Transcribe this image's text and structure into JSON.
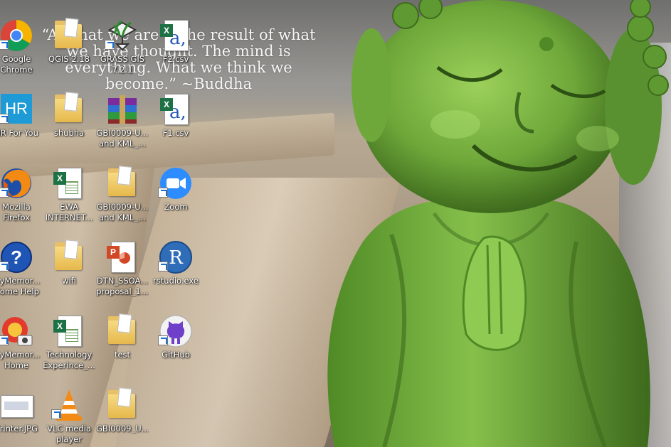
{
  "wallpaper": {
    "quote": "“All that we are is the result of what we have thought. The mind is everything. What we think we become.” ~Buddha",
    "statue_color": "#6fa83a"
  },
  "icons": [
    {
      "id": "chrome",
      "label": "Google\nChrome",
      "icon": "chrome-icon",
      "shortcut": true
    },
    {
      "id": "qgis",
      "label": "QGIS 2.18",
      "icon": "folder-icon",
      "shortcut": false
    },
    {
      "id": "grass",
      "label": "GRASS GIS\n7.2.1",
      "icon": "grass-gis-icon",
      "shortcut": true
    },
    {
      "id": "f2csv",
      "label": "F2.csv",
      "icon": "csv-file-icon",
      "shortcut": false
    },
    {
      "id": "hrforyou",
      "label": "HR For You",
      "icon": "hr-icon",
      "shortcut": true
    },
    {
      "id": "shubha",
      "label": "shubha",
      "icon": "folder-icon",
      "shortcut": false
    },
    {
      "id": "gbi-rar",
      "label": "GBI0009-U...\nand KML_...",
      "icon": "winrar-icon",
      "shortcut": false
    },
    {
      "id": "f1csv",
      "label": "F1.csv",
      "icon": "csv-file-icon",
      "shortcut": false
    },
    {
      "id": "firefox",
      "label": "Mozilla\nFirefox",
      "icon": "firefox-icon",
      "shortcut": true
    },
    {
      "id": "ewa",
      "label": "EWA\nINTERNET...",
      "icon": "excel-file-icon",
      "shortcut": false
    },
    {
      "id": "gbi-folder",
      "label": "GBI0009-U...\nand KML_...",
      "icon": "folder-icon",
      "shortcut": false
    },
    {
      "id": "zoom",
      "label": "Zoom",
      "icon": "zoom-icon",
      "shortcut": true
    },
    {
      "id": "mymemories-help",
      "label": "MyMemor...\nHome Help",
      "icon": "help-icon",
      "shortcut": true
    },
    {
      "id": "wifi",
      "label": "wifi",
      "icon": "folder-icon",
      "shortcut": false
    },
    {
      "id": "dtn",
      "label": "DTN_SSOA...\nproposal_1...",
      "icon": "powerpoint-file-icon",
      "shortcut": false
    },
    {
      "id": "rstudio",
      "label": "rstudio.exe",
      "icon": "r-icon",
      "shortcut": true
    },
    {
      "id": "mymemories-home",
      "label": "MyMemor...\nHome",
      "icon": "mymemories-icon",
      "shortcut": true
    },
    {
      "id": "techexp",
      "label": "Technology\nExperince_...",
      "icon": "excel-file-icon",
      "shortcut": false
    },
    {
      "id": "test",
      "label": "test",
      "icon": "folder-icon",
      "shortcut": false
    },
    {
      "id": "github",
      "label": "GitHub",
      "icon": "github-icon",
      "shortcut": true
    },
    {
      "id": "printer",
      "label": "Printer.JPG",
      "icon": "image-file-icon",
      "shortcut": false
    },
    {
      "id": "vlc",
      "label": "VLC media\nplayer",
      "icon": "vlc-icon",
      "shortcut": true
    },
    {
      "id": "gbi-folder2",
      "label": "GBI0009_U...",
      "icon": "folder-icon",
      "shortcut": false
    }
  ]
}
